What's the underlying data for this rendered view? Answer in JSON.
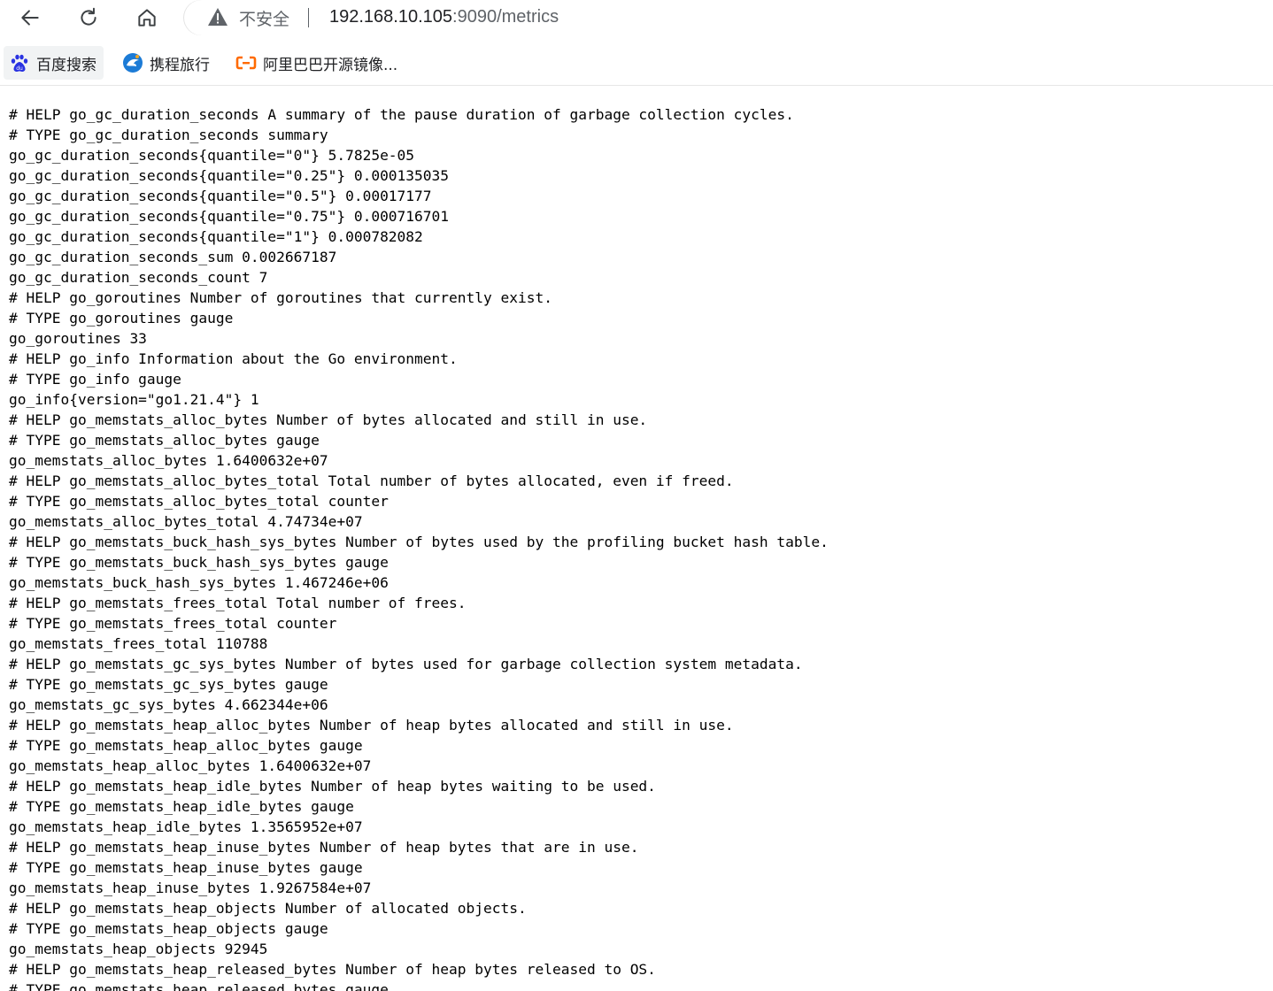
{
  "browser": {
    "security_label": "不安全",
    "url_host": "192.168.10.105",
    "url_rest": ":9090/metrics",
    "icons": [
      "back-arrow-icon",
      "reload-icon",
      "home-icon",
      "warning-triangle-icon"
    ]
  },
  "bookmarks": [
    {
      "label": "百度搜索",
      "icon": "baidu-paw-icon",
      "color": "#2932e1"
    },
    {
      "label": "携程旅行",
      "icon": "ctrip-dolphin-icon",
      "color": "#1c7bd6"
    },
    {
      "label": "阿里巴巴开源镜像...",
      "icon": "aliyun-logo-icon",
      "color": "#ff6a00"
    }
  ],
  "metrics_lines": [
    "# HELP go_gc_duration_seconds A summary of the pause duration of garbage collection cycles.",
    "# TYPE go_gc_duration_seconds summary",
    "go_gc_duration_seconds{quantile=\"0\"} 5.7825e-05",
    "go_gc_duration_seconds{quantile=\"0.25\"} 0.000135035",
    "go_gc_duration_seconds{quantile=\"0.5\"} 0.00017177",
    "go_gc_duration_seconds{quantile=\"0.75\"} 0.000716701",
    "go_gc_duration_seconds{quantile=\"1\"} 0.000782082",
    "go_gc_duration_seconds_sum 0.002667187",
    "go_gc_duration_seconds_count 7",
    "# HELP go_goroutines Number of goroutines that currently exist.",
    "# TYPE go_goroutines gauge",
    "go_goroutines 33",
    "# HELP go_info Information about the Go environment.",
    "# TYPE go_info gauge",
    "go_info{version=\"go1.21.4\"} 1",
    "# HELP go_memstats_alloc_bytes Number of bytes allocated and still in use.",
    "# TYPE go_memstats_alloc_bytes gauge",
    "go_memstats_alloc_bytes 1.6400632e+07",
    "# HELP go_memstats_alloc_bytes_total Total number of bytes allocated, even if freed.",
    "# TYPE go_memstats_alloc_bytes_total counter",
    "go_memstats_alloc_bytes_total 4.74734e+07",
    "# HELP go_memstats_buck_hash_sys_bytes Number of bytes used by the profiling bucket hash table.",
    "# TYPE go_memstats_buck_hash_sys_bytes gauge",
    "go_memstats_buck_hash_sys_bytes 1.467246e+06",
    "# HELP go_memstats_frees_total Total number of frees.",
    "# TYPE go_memstats_frees_total counter",
    "go_memstats_frees_total 110788",
    "# HELP go_memstats_gc_sys_bytes Number of bytes used for garbage collection system metadata.",
    "# TYPE go_memstats_gc_sys_bytes gauge",
    "go_memstats_gc_sys_bytes 4.662344e+06",
    "# HELP go_memstats_heap_alloc_bytes Number of heap bytes allocated and still in use.",
    "# TYPE go_memstats_heap_alloc_bytes gauge",
    "go_memstats_heap_alloc_bytes 1.6400632e+07",
    "# HELP go_memstats_heap_idle_bytes Number of heap bytes waiting to be used.",
    "# TYPE go_memstats_heap_idle_bytes gauge",
    "go_memstats_heap_idle_bytes 1.3565952e+07",
    "# HELP go_memstats_heap_inuse_bytes Number of heap bytes that are in use.",
    "# TYPE go_memstats_heap_inuse_bytes gauge",
    "go_memstats_heap_inuse_bytes 1.9267584e+07",
    "# HELP go_memstats_heap_objects Number of allocated objects.",
    "# TYPE go_memstats_heap_objects gauge",
    "go_memstats_heap_objects 92945",
    "# HELP go_memstats_heap_released_bytes Number of heap bytes released to OS.",
    "# TYPE go_memstats_heap_released_bytes gauge"
  ]
}
